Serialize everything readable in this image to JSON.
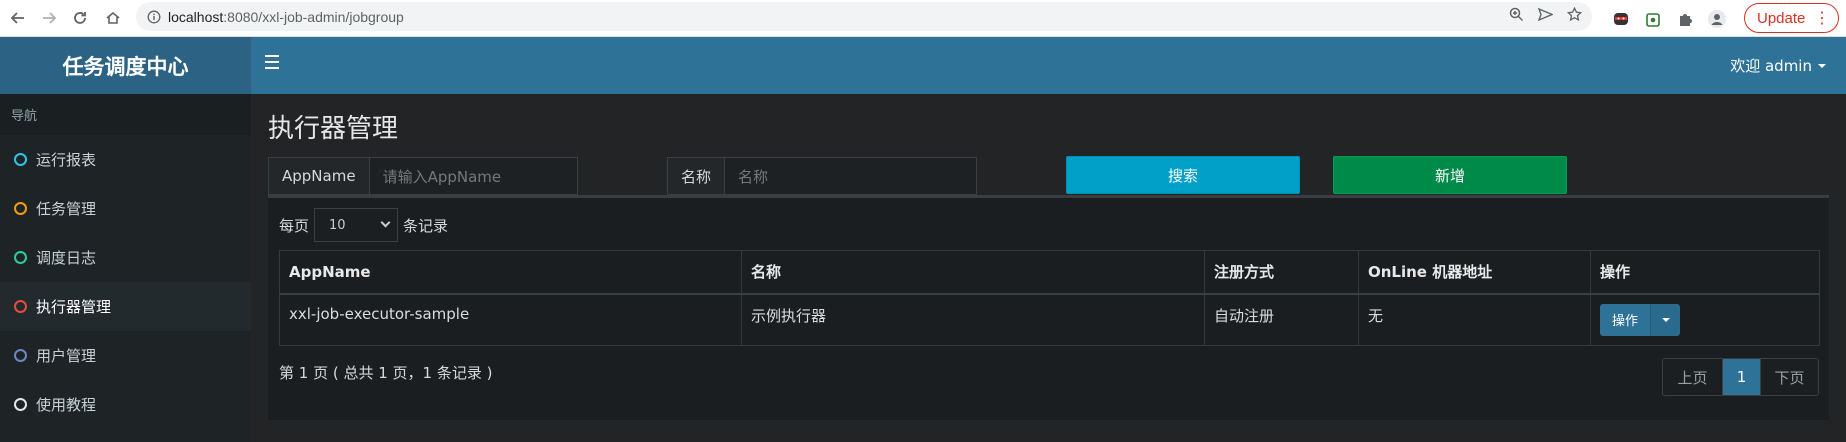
{
  "browser": {
    "url_host": "localhost",
    "url_path": ":8080/xxl-job-admin/jobgroup",
    "update_label": "Update"
  },
  "app": {
    "logo": "任务调度中心",
    "user_greeting": "欢迎 admin"
  },
  "sidebar": {
    "header": "导航",
    "items": [
      {
        "label": "运行报表",
        "color": "#2fc3e6"
      },
      {
        "label": "任务管理",
        "color": "#f39c12"
      },
      {
        "label": "调度日志",
        "color": "#2ecc9a"
      },
      {
        "label": "执行器管理",
        "color": "#e74c3c"
      },
      {
        "label": "用户管理",
        "color": "#6c86c7"
      },
      {
        "label": "使用教程",
        "color": "#e6e6e6"
      }
    ],
    "active_index": 3
  },
  "page": {
    "title": "执行器管理"
  },
  "filters": {
    "appname_label": "AppName",
    "appname_placeholder": "请输入AppName",
    "name_label": "名称",
    "name_placeholder": "名称",
    "search_label": "搜索",
    "add_label": "新增"
  },
  "list": {
    "per_page_prefix": "每页",
    "per_page_value": "10",
    "per_page_suffix": "条记录",
    "columns": [
      "AppName",
      "名称",
      "注册方式",
      "OnLine 机器地址",
      "操作"
    ],
    "rows": [
      {
        "appname": "xxl-job-executor-sample",
        "name": "示例执行器",
        "reg_type": "自动注册",
        "online": "无",
        "op_label": "操作"
      }
    ],
    "info": "第 1 页 ( 总共 1 页，1 条记录 )",
    "pager": {
      "prev": "上页",
      "current": "1",
      "next": "下页"
    }
  }
}
